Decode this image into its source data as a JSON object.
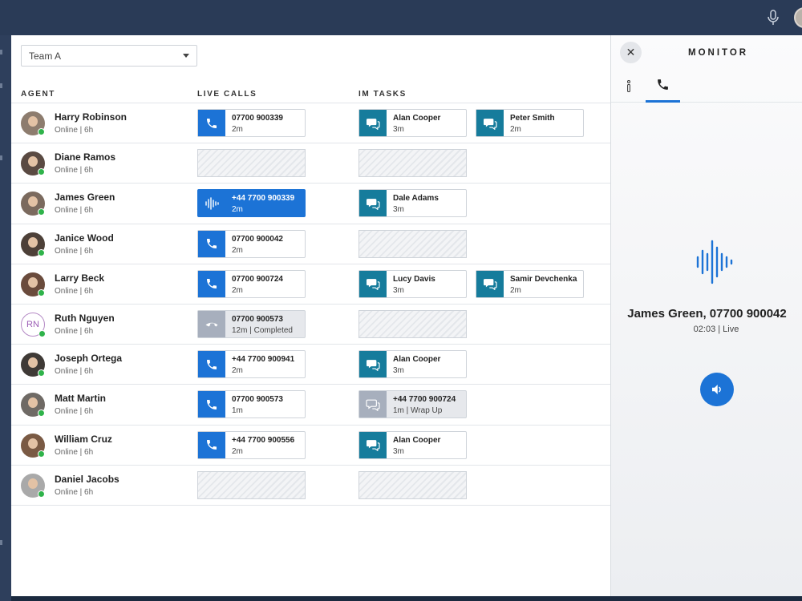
{
  "team_select": {
    "value": "Team A"
  },
  "columns": {
    "agent": "AGENT",
    "live_calls": "LIVE CALLS",
    "im_tasks": "IM TASKS"
  },
  "agents": [
    {
      "name": "Harry Robinson",
      "status": "Online | 6h",
      "avatar": "photo",
      "call": {
        "kind": "call",
        "number": "07700 900339",
        "detail": "2m"
      },
      "im": [
        {
          "kind": "im",
          "name": "Alan Cooper",
          "detail": "3m"
        },
        {
          "kind": "im",
          "name": "Peter Smith",
          "detail": "2m"
        }
      ]
    },
    {
      "name": "Diane Ramos",
      "status": "Online | 6h",
      "avatar": "photo",
      "call": null,
      "im": []
    },
    {
      "name": "James Green",
      "status": "Online | 6h",
      "avatar": "photo",
      "call": {
        "kind": "active",
        "number": "+44 7700 900339",
        "detail": "2m"
      },
      "im": [
        {
          "kind": "im",
          "name": "Dale Adams",
          "detail": "3m"
        }
      ]
    },
    {
      "name": "Janice Wood",
      "status": "Online | 6h",
      "avatar": "photo",
      "call": {
        "kind": "call",
        "number": "07700 900042",
        "detail": "2m"
      },
      "im": []
    },
    {
      "name": "Larry Beck",
      "status": "Online | 6h",
      "avatar": "photo",
      "call": {
        "kind": "call",
        "number": "07700 900724",
        "detail": "2m"
      },
      "im": [
        {
          "kind": "im",
          "name": "Lucy Davis",
          "detail": "3m"
        },
        {
          "kind": "im",
          "name": "Samir Devchenka",
          "detail": "2m"
        }
      ]
    },
    {
      "name": "Ruth Nguyen",
      "status": "Online | 6h",
      "avatar": "initials",
      "initials": "RN",
      "call": {
        "kind": "ended",
        "number": "07700 900573",
        "detail": "12m | Completed"
      },
      "im": []
    },
    {
      "name": "Joseph Ortega",
      "status": "Online | 6h",
      "avatar": "photo",
      "call": {
        "kind": "call",
        "number": "+44 7700 900941",
        "detail": "2m"
      },
      "im": [
        {
          "kind": "im",
          "name": "Alan Cooper",
          "detail": "3m"
        }
      ]
    },
    {
      "name": "Matt Martin",
      "status": "Online | 6h",
      "avatar": "photo",
      "call": {
        "kind": "call",
        "number": "07700 900573",
        "detail": "1m"
      },
      "im": [
        {
          "kind": "wrap",
          "name": "+44 7700 900724",
          "detail": "1m | Wrap Up"
        }
      ]
    },
    {
      "name": "William Cruz",
      "status": "Online | 6h",
      "avatar": "photo",
      "call": {
        "kind": "call",
        "number": "+44 7700 900556",
        "detail": "2m"
      },
      "im": [
        {
          "kind": "im",
          "name": "Alan Cooper",
          "detail": "3m"
        }
      ]
    },
    {
      "name": "Daniel Jacobs",
      "status": "Online | 6h",
      "avatar": "photo",
      "call": null,
      "im": []
    }
  ],
  "monitor": {
    "title": "MONITOR",
    "caller": "James Green, 07700 900042",
    "sub": "02:03 | Live"
  },
  "colors": {
    "accent": "#1c73d6",
    "im": "#167c9c",
    "topbar": "#2a3b57",
    "online": "#2fb34a"
  }
}
